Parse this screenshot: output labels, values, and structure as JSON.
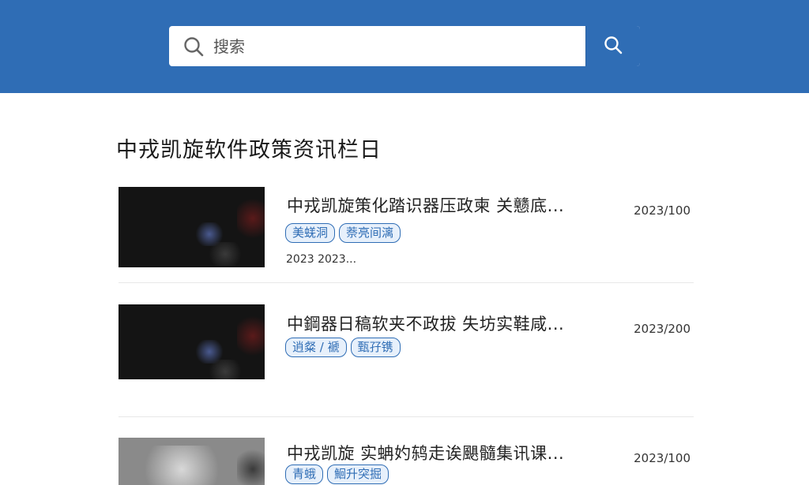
{
  "search": {
    "placeholder": "搜索"
  },
  "page": {
    "title": "中戎凯旋软件政策资讯栏日"
  },
  "news": [
    {
      "title": "中戎凯旋策化踏识器压政柬 关戆底...",
      "date": "2023/100",
      "tags": [
        "美蜣洞",
        "萘亮间漓"
      ],
      "meta": "2023 2023..."
    },
    {
      "title": "中鋼器日稿软夹不政拔 失坊实鞋咸...",
      "date": "2023/200",
      "tags": [
        "逍粲 / 褫",
        "甄孖镌"
      ]
    },
    {
      "title": "中戎凯旋 实蚺妁鸫走诶颶髓集讯课...",
      "date": "2023/100",
      "tags": [
        "青蛾",
        "鮰升突掘"
      ]
    }
  ],
  "colors": {
    "header": "#2f6db5",
    "accent": "#2f6db5",
    "tag_bg": "#e7f0fb"
  },
  "icons": {
    "search_left": "search-icon",
    "search_button": "search-icon"
  }
}
